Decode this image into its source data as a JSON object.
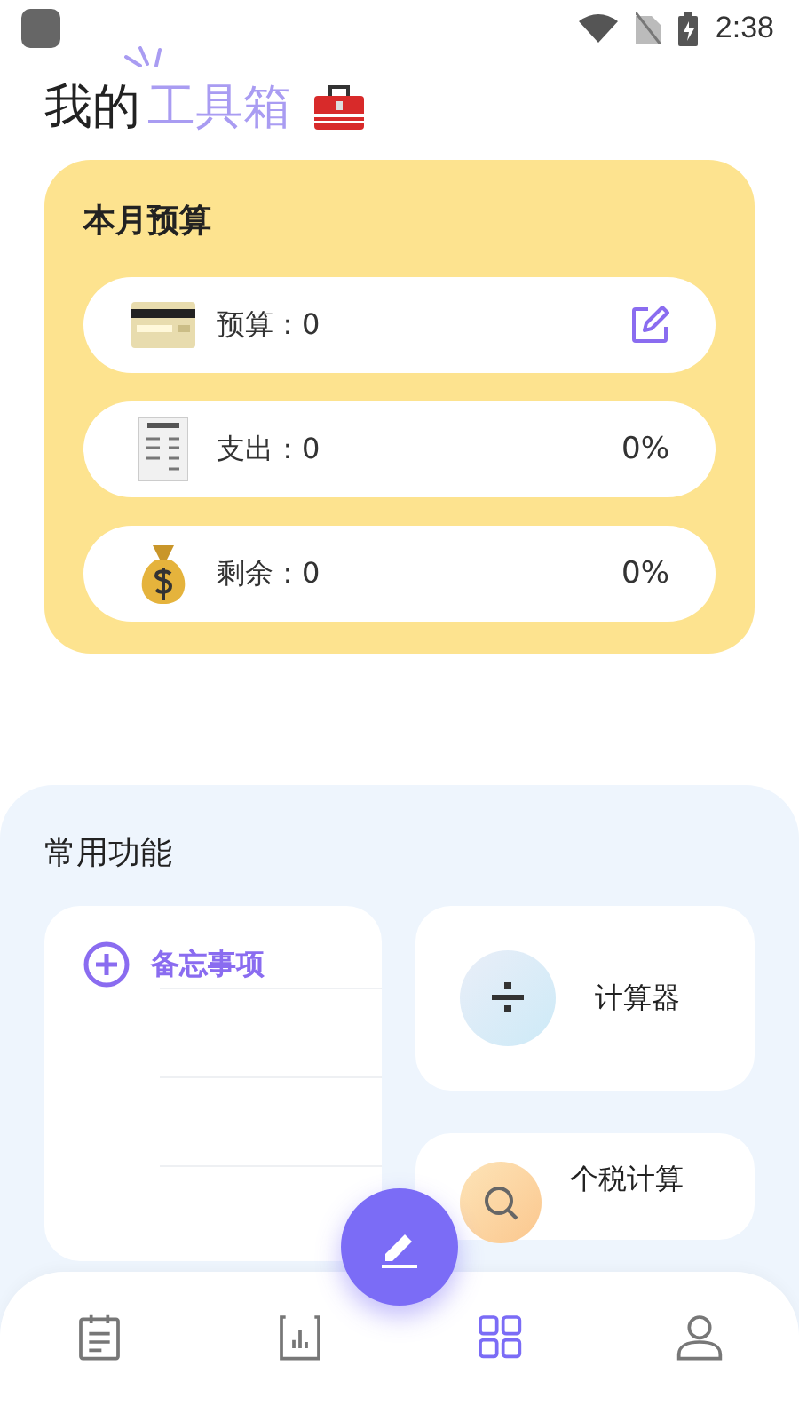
{
  "status_bar": {
    "time": "2:38"
  },
  "header": {
    "title_plain": "我的",
    "title_accent": "工具箱"
  },
  "budget": {
    "title": "本月预算",
    "rows": [
      {
        "kind": "budget",
        "label": "预算：0"
      },
      {
        "kind": "expense",
        "label": "支出：0",
        "percent": "0%"
      },
      {
        "kind": "remaining",
        "label": "剩余：0",
        "percent": "0%"
      }
    ]
  },
  "tools": {
    "title": "常用功能",
    "memo": {
      "label": "备忘事项"
    },
    "items": [
      {
        "kind": "calculator",
        "label": "计算器"
      },
      {
        "kind": "tax",
        "label": "个税计算"
      }
    ]
  },
  "bottom_nav": {
    "tabs": [
      {
        "kind": "notes",
        "selected": false
      },
      {
        "kind": "chart",
        "selected": false
      },
      {
        "kind": "apps",
        "selected": true
      },
      {
        "kind": "profile",
        "selected": false
      }
    ]
  }
}
